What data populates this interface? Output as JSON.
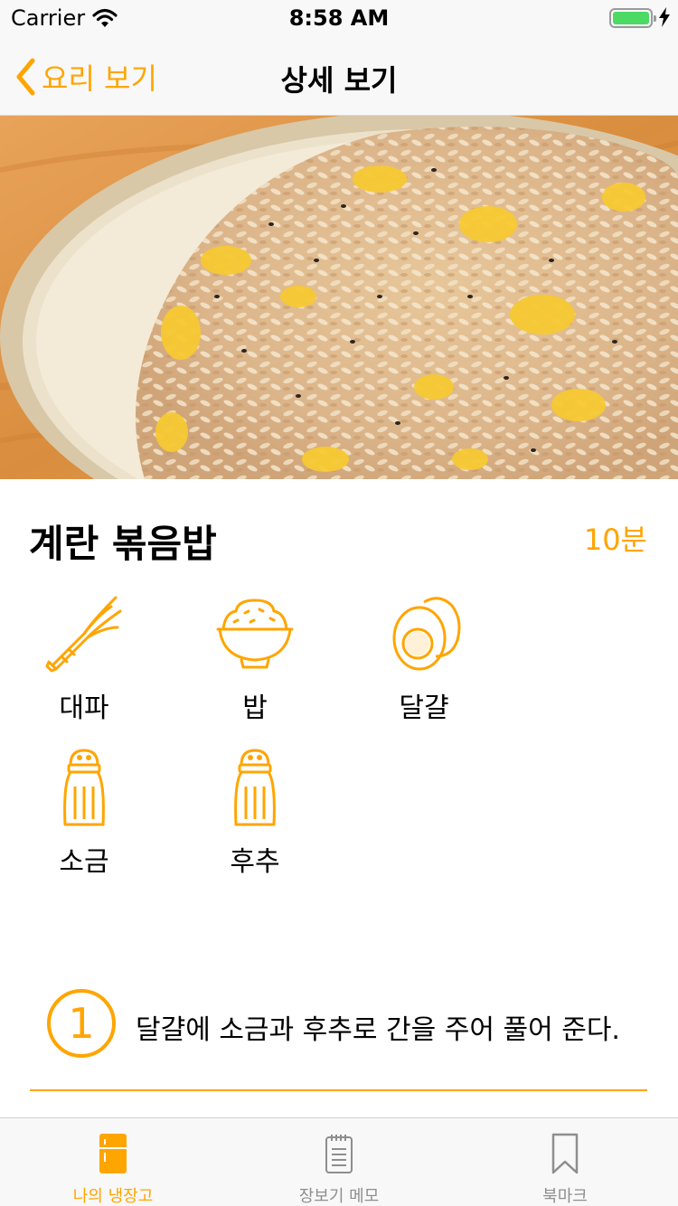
{
  "status_bar": {
    "carrier": "Carrier",
    "time": "8:58 AM",
    "battery_level": 1.0
  },
  "nav": {
    "back_label": "요리 보기",
    "title": "상세 보기"
  },
  "recipe": {
    "name": "계란 볶음밥",
    "time": "10분",
    "ingredients": [
      {
        "label": "대파",
        "icon": "green-onion-icon"
      },
      {
        "label": "밥",
        "icon": "rice-bowl-icon"
      },
      {
        "label": "달걀",
        "icon": "egg-icon"
      },
      {
        "label": "소금",
        "icon": "salt-shaker-icon"
      },
      {
        "label": "후추",
        "icon": "pepper-shaker-icon"
      }
    ],
    "steps": [
      {
        "number": "1",
        "text": "달걀에 소금과 후추로 간을 주어 풀어 준다."
      }
    ]
  },
  "tabs": [
    {
      "label": "나의 냉장고",
      "icon": "refrigerator-icon",
      "active": true
    },
    {
      "label": "장보기 메모",
      "icon": "notepad-icon",
      "active": false
    },
    {
      "label": "북마크",
      "icon": "bookmark-icon",
      "active": false
    }
  ],
  "colors": {
    "accent": "#ffa500",
    "inactive": "#8e8e8e",
    "bar_background": "#f8f8f8",
    "battery": "#4cd964"
  }
}
